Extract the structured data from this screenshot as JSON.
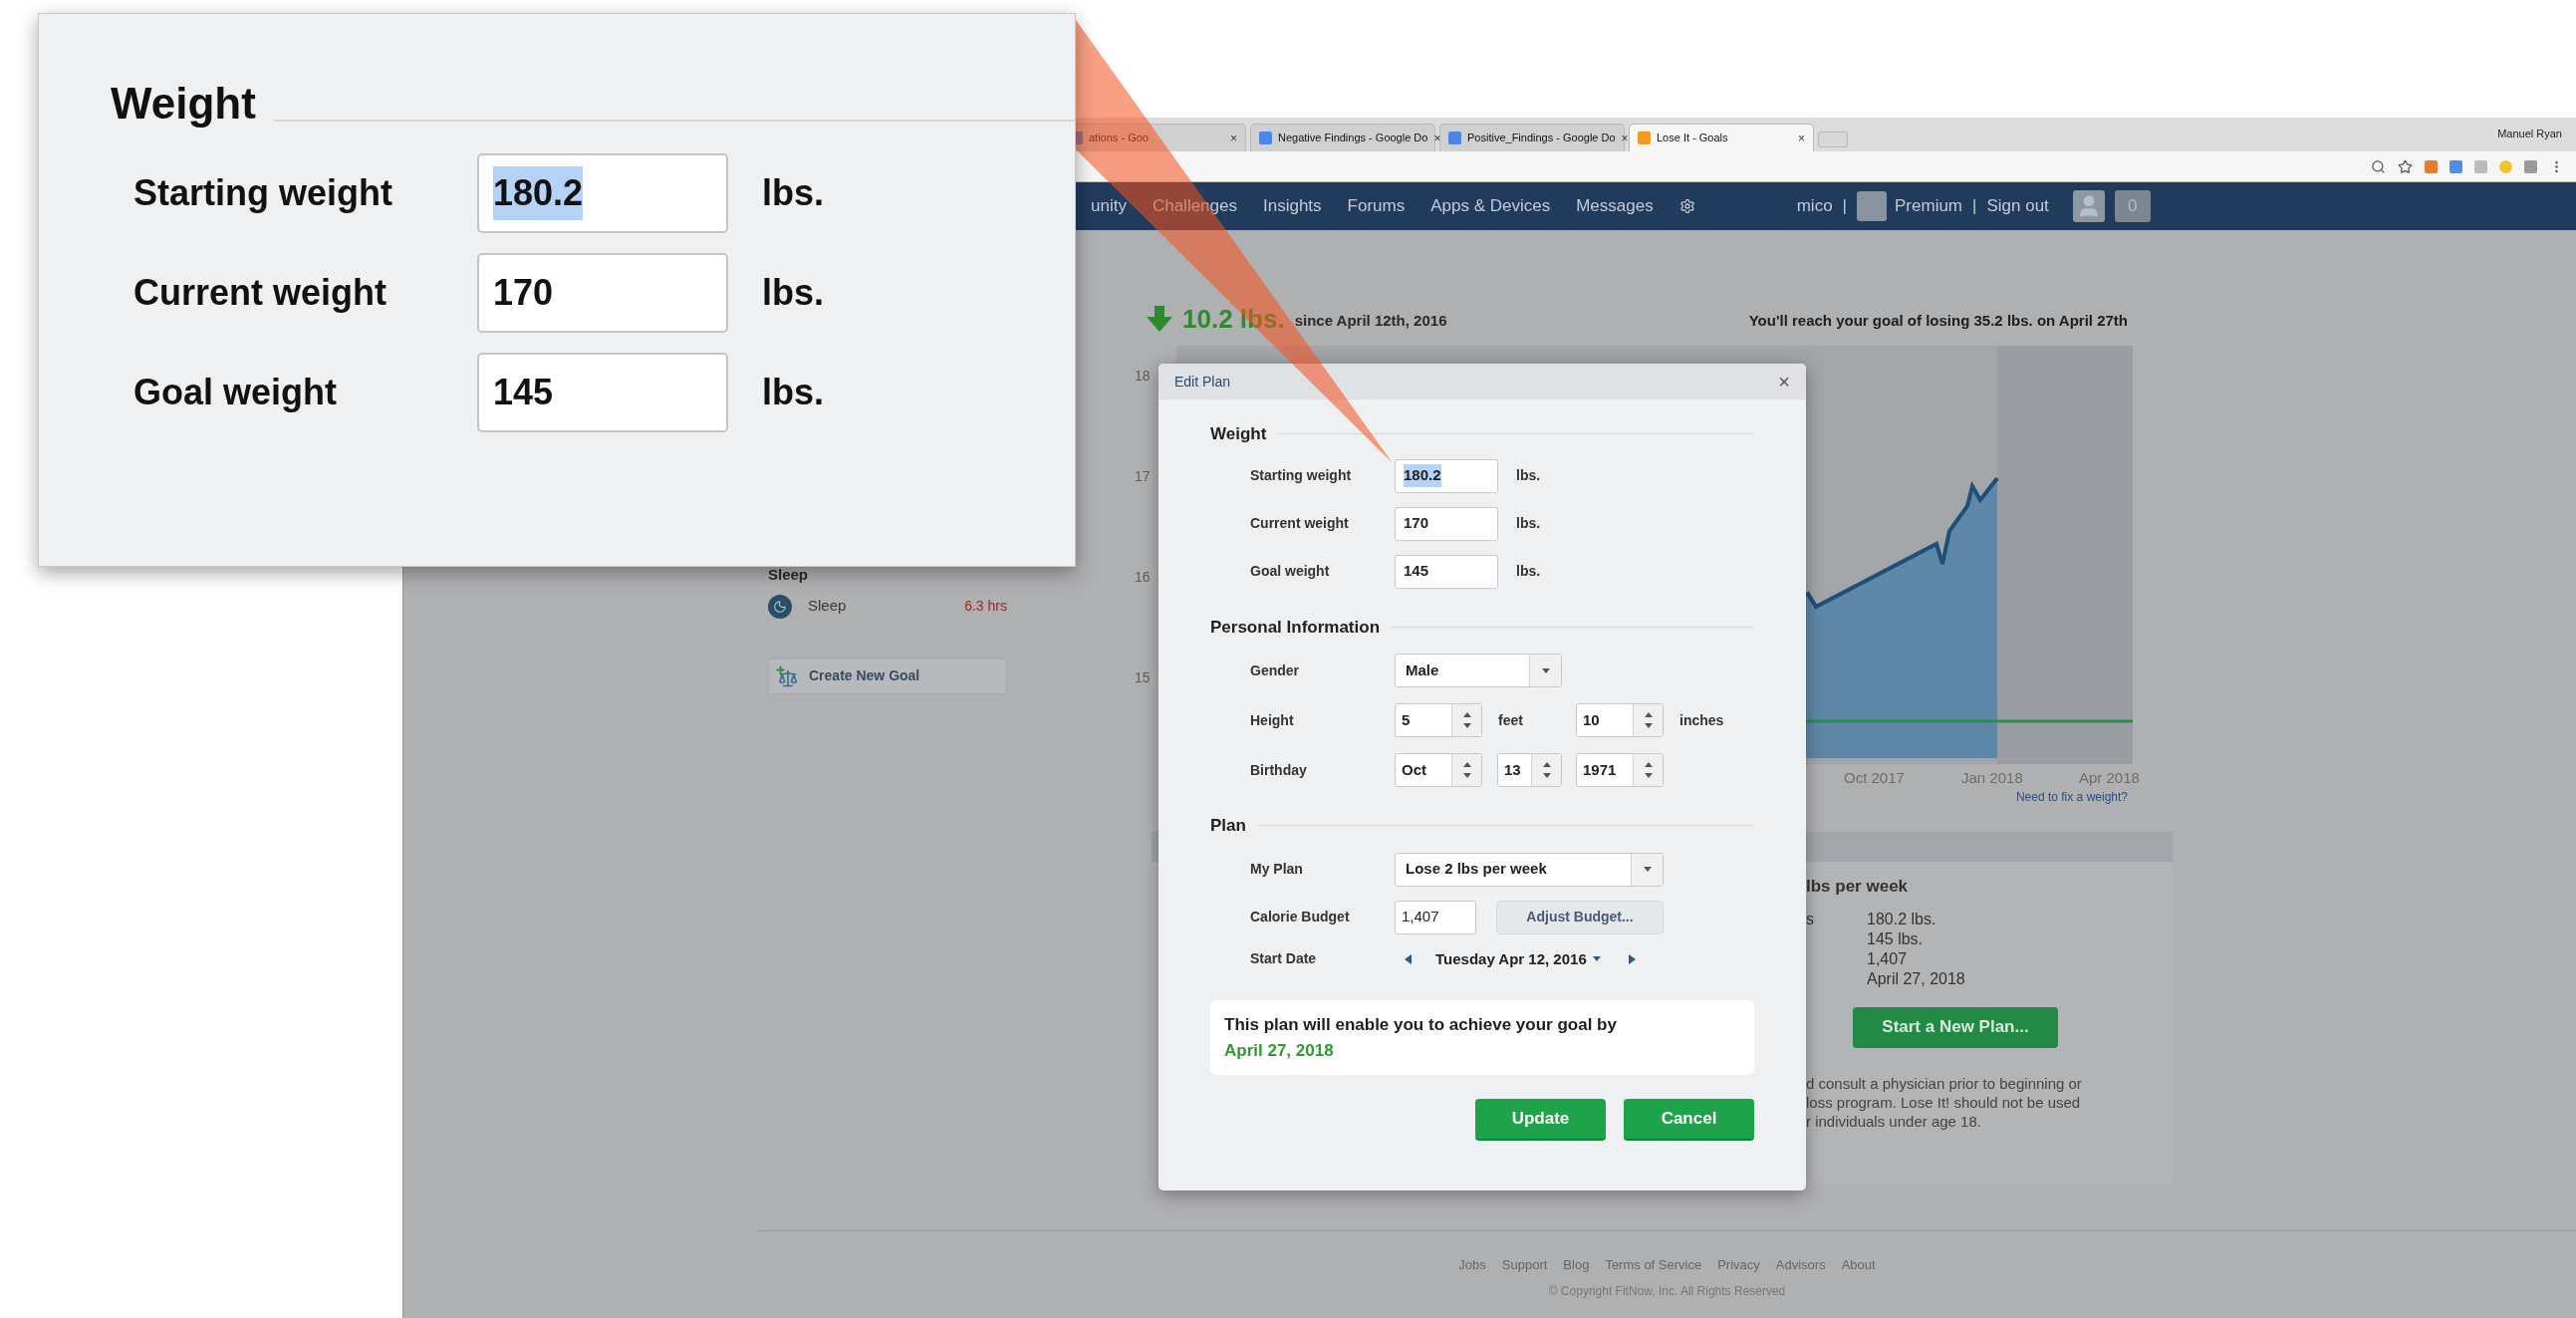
{
  "browser": {
    "tabs": [
      {
        "title": "ations - Goo",
        "close": "×",
        "kind": "doc",
        "selected": false
      },
      {
        "title": "Negative Findings - Google Do",
        "close": "×",
        "kind": "doc",
        "selected": false
      },
      {
        "title": "Positive_Findings - Google Do",
        "close": "×",
        "kind": "doc",
        "selected": false
      },
      {
        "title": "Lose It - Goals",
        "close": "×",
        "kind": "app",
        "selected": true
      }
    ],
    "profile_name": "Manuel Ryan"
  },
  "nav": {
    "items": [
      "unity",
      "Challenges",
      "Insights",
      "Forums",
      "Apps & Devices",
      "Messages"
    ],
    "user_menu": [
      {
        "kind": "text",
        "label": "mico"
      },
      {
        "kind": "sep",
        "label": "|"
      },
      {
        "kind": "premium",
        "label": "Premium"
      },
      {
        "kind": "sep",
        "label": "|"
      },
      {
        "kind": "link",
        "label": "Sign out"
      }
    ],
    "badge": "0"
  },
  "page": {
    "weight_lost": "10.2 lbs.",
    "since": "since April 12th, 2016",
    "goal_message": "You'll reach your goal of losing 35.2 lbs. on April 27th",
    "chart": {
      "y_labels": [
        "18",
        "17",
        "16",
        "15"
      ],
      "x_labels": [
        "Oct 2017",
        "Jan 2018",
        "Apr 2018"
      ],
      "fix_link": "Need to fix a weight?"
    },
    "sleep": {
      "heading": "Sleep",
      "item": "Sleep",
      "value": "6.3 hrs"
    },
    "create_goal": "Create New Goal",
    "plan_summary": {
      "heading": "lbs per week",
      "rows": [
        {
          "label": "s",
          "value": "180.2 lbs."
        },
        {
          "label": "",
          "value": "145 lbs."
        },
        {
          "label": "",
          "value": "1,407"
        },
        {
          "label": "",
          "value": "April 27, 2018"
        }
      ],
      "button": "Start a New Plan...",
      "disclaimer": [
        "d consult a physician prior to beginning or",
        "loss program. Lose It! should not be used",
        "r individuals under age 18."
      ]
    }
  },
  "footer": {
    "links": [
      "Jobs",
      "Support",
      "Blog",
      "Terms of Service",
      "Privacy",
      "Advisors",
      "About"
    ],
    "copyright": "© Copyright FitNow, Inc. All Rights Reserved"
  },
  "modal": {
    "title": "Edit Plan",
    "close": "×",
    "weight": {
      "heading": "Weight",
      "rows": [
        {
          "label": "Starting weight",
          "value": "180.2",
          "unit": "lbs.",
          "selected": true
        },
        {
          "label": "Current weight",
          "value": "170",
          "unit": "lbs.",
          "selected": false
        },
        {
          "label": "Goal weight",
          "value": "145",
          "unit": "lbs.",
          "selected": false
        }
      ]
    },
    "personal": {
      "heading": "Personal Information",
      "gender": {
        "label": "Gender",
        "value": "Male"
      },
      "height": {
        "label": "Height",
        "feet": "5",
        "feet_unit": "feet",
        "inches": "10",
        "inches_unit": "inches"
      },
      "birthday": {
        "label": "Birthday",
        "month": "Oct",
        "day": "13",
        "year": "1971"
      }
    },
    "plan": {
      "heading": "Plan",
      "my_plan": {
        "label": "My Plan",
        "value": "Lose 2 lbs per week"
      },
      "calorie_budget": {
        "label": "Calorie Budget",
        "value": "1,407",
        "button": "Adjust Budget..."
      },
      "start_date": {
        "label": "Start Date",
        "value": "Tuesday Apr 12, 2016"
      }
    },
    "message": {
      "text": "This plan will enable you to achieve your goal by",
      "date": "April 27, 2018"
    },
    "buttons": [
      "Update",
      "Cancel"
    ]
  },
  "callout": {
    "heading": "Weight",
    "rows": [
      {
        "label": "Starting weight",
        "value": "180.2",
        "unit": "lbs.",
        "selected": true
      },
      {
        "label": "Current weight",
        "value": "170",
        "unit": "lbs.",
        "selected": false
      },
      {
        "label": "Goal weight",
        "value": "145",
        "unit": "lbs.",
        "selected": false
      }
    ]
  }
}
